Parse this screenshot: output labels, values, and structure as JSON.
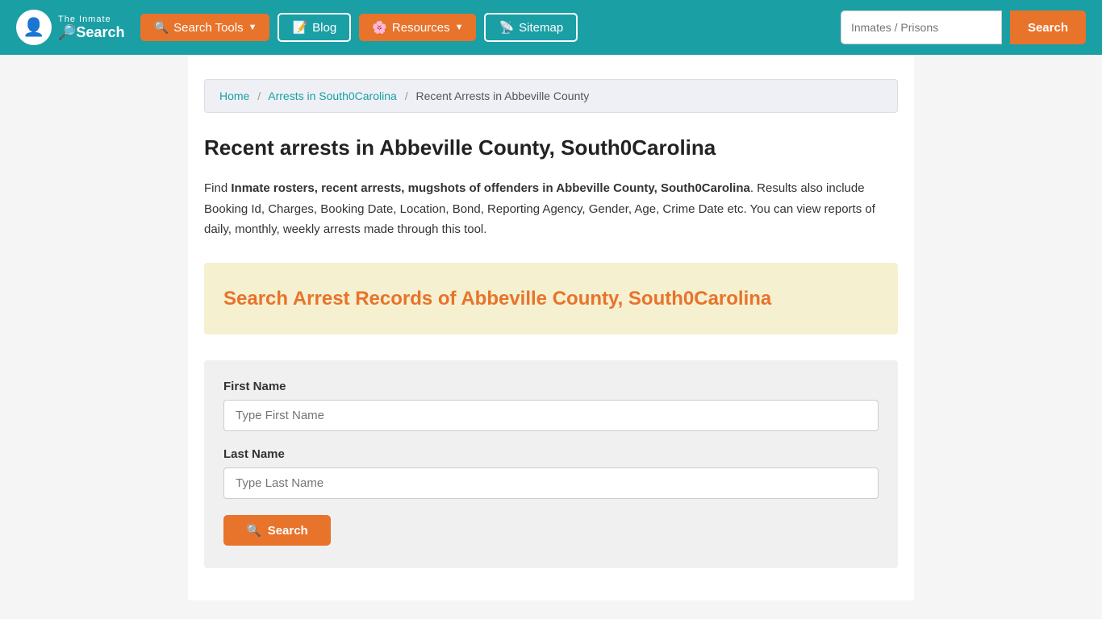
{
  "navbar": {
    "brand": {
      "logo_icon": "🔍",
      "title": "The Inmate Search",
      "title_line1": "The Inmate",
      "title_line2": "🔎Search"
    },
    "buttons": [
      {
        "id": "search-tools",
        "label": "Search Tools",
        "has_dropdown": true
      },
      {
        "id": "blog",
        "label": "Blog",
        "has_dropdown": false
      },
      {
        "id": "resources",
        "label": "Resources",
        "has_dropdown": true
      },
      {
        "id": "sitemap",
        "label": "Sitemap",
        "has_dropdown": false
      }
    ],
    "search": {
      "placeholder": "Inmates / Prisons",
      "button_label": "Search"
    }
  },
  "breadcrumb": {
    "items": [
      {
        "label": "Home",
        "href": "#"
      },
      {
        "label": "Arrests in South0Carolina",
        "href": "#"
      },
      {
        "label": "Recent Arrests in Abbeville County",
        "href": null
      }
    ]
  },
  "page": {
    "title": "Recent arrests in Abbeville County, South0Carolina",
    "description_part1": "Find ",
    "description_bold": "Inmate rosters, recent arrests, mugshots of offenders in Abbeville County, South0Carolina",
    "description_part2": ". Results also include Booking Id, Charges, Booking Date, Location, Bond, Reporting Agency, Gender, Age, Crime Date etc. You can view reports of daily, monthly, weekly arrests made through this tool.",
    "search_banner_title": "Search Arrest Records of Abbeville County, South0Carolina",
    "form": {
      "first_name_label": "First Name",
      "first_name_placeholder": "Type First Name",
      "last_name_label": "Last Name",
      "last_name_placeholder": "Type Last Name",
      "submit_label": "Search"
    }
  },
  "icons": {
    "search_tools": "🔍",
    "blog": "📝",
    "resources": "🌸",
    "sitemap": "📡",
    "search": "🔍"
  }
}
